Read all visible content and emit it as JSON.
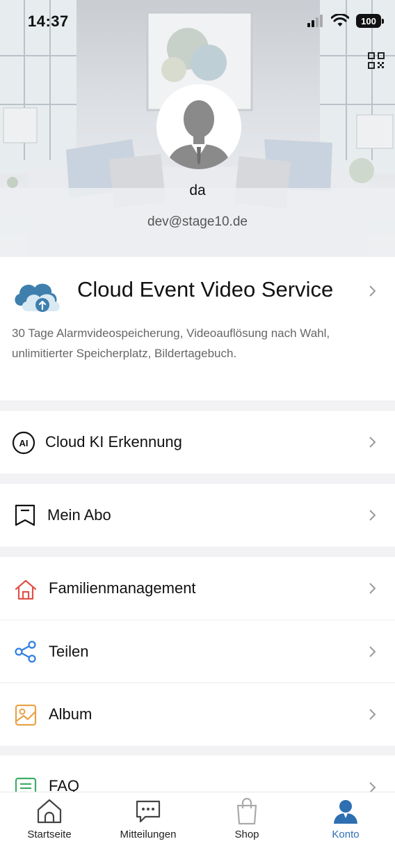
{
  "status_bar": {
    "time": "14:37",
    "battery": "100"
  },
  "profile": {
    "username": "da",
    "email": "dev@stage10.de"
  },
  "cloud_service": {
    "title": "Cloud Event Video Service",
    "description": "30 Tage Alarmvideospeicherung, Videoauflösung nach Wahl, unlimitierter Speicherplatz, Bildertagebuch."
  },
  "menu": {
    "ai_detection": "Cloud KI Erkennung",
    "ai_badge": "AI",
    "subscription": "Mein Abo",
    "family": "Familienmanagement",
    "share": "Teilen",
    "album": "Album",
    "faq": "FAQ"
  },
  "tabs": {
    "home": "Startseite",
    "messages": "Mitteilungen",
    "shop": "Shop",
    "account": "Konto"
  },
  "colors": {
    "accent_blue": "#2d6fb1",
    "home_red": "#e0524a",
    "share_blue": "#2f7fe0",
    "album_orange": "#e9a246",
    "faq_green": "#3cae66"
  }
}
